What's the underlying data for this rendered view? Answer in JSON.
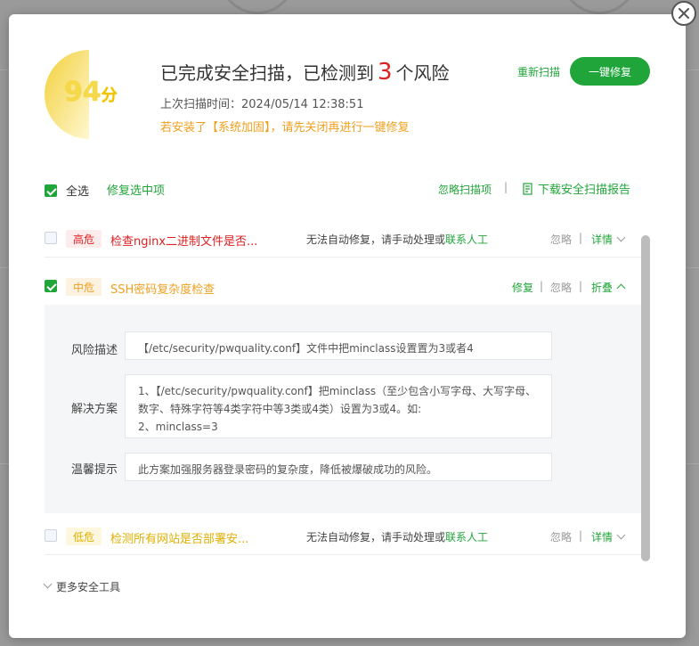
{
  "dialog": {
    "score": {
      "value": "94",
      "unit": "分"
    },
    "title_prefix": "已完成安全扫描，已检测到",
    "risk_count": "3",
    "title_suffix": "个风险",
    "last_scan_label": "上次扫描时间：",
    "last_scan_time": "2024/05/14 12:38:51",
    "warning": "若安装了【系统加固】，请先关闭再进行一键修复",
    "rescan_label": "重新扫描",
    "fix_all_label": "一键修复"
  },
  "toolbar": {
    "select_all_label": "全选",
    "fix_selected_label": "修复选中项",
    "ignore_items_label": "忽略扫描项",
    "download_report_label": "下载安全扫描报告"
  },
  "risks": [
    {
      "level": "高危",
      "title": "检查nginx二进制文件是否...",
      "msg": "无法自动修复，请手动处理或",
      "msg_link": "联系人工",
      "ignore": "忽略",
      "detail": "详情"
    },
    {
      "level": "中危",
      "title": "SSH密码复杂度检查",
      "fix": "修复",
      "ignore": "忽略",
      "collapse": "折叠"
    },
    {
      "level": "低危",
      "title": "检测所有网站是否部署安...",
      "msg": "无法自动修复，请手动处理或",
      "msg_link": "联系人工",
      "ignore": "忽略",
      "detail": "详情"
    }
  ],
  "detail": {
    "desc_label": "风险描述",
    "desc": "【/etc/security/pwquality.conf】文件中把minclass设置置为3或者4",
    "solution_label": "解决方案",
    "solution_line1": "1、【/etc/security/pwquality.conf】把minclass（至少包含小写字母、大写字母、数字、特殊字符等4类字符中等3类或4类）设置为3或4。如:",
    "solution_line2": "2、minclass=3",
    "tip_label": "温馨提示",
    "tip": "此方案加强服务器登录密码的复杂度，降低被爆破成功的风险。"
  },
  "footer": {
    "more_tools_label": "更多安全工具"
  },
  "colors": {
    "accent": "#20a53a",
    "danger": "#e02020",
    "warning": "#f0a020",
    "score": "#f5d94a"
  }
}
